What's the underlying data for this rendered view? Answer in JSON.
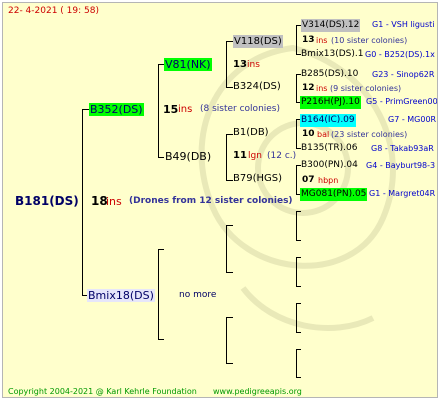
{
  "header": {
    "text": "22-  4-2021  ( 19: 58)"
  },
  "footer": {
    "copyright": "Copyright 2004-2021 @ Karl Kehrle Foundation",
    "website": "www.pedigreeapis.org"
  },
  "root": {
    "id": "B181(DS)",
    "number": "18",
    "ins": "ins",
    "note": "(Drones from 12 sister colonies)"
  },
  "gen1": [
    {
      "id": "B352(DS)",
      "number": "15",
      "ins": "ins",
      "note": "(8 sister colonies)"
    },
    {
      "id": "Bmix18(DS)",
      "note": "no more"
    }
  ],
  "gen2": [
    {
      "id": "V81(NK)",
      "number": "13",
      "ins": "ins"
    },
    {
      "id": "B49(DB)",
      "number": "11",
      "ins": "lgn",
      "note": "(12 c.)"
    }
  ],
  "gen3": [
    {
      "id": "V118(DS)"
    },
    {
      "id": "B324(DS)"
    },
    {
      "id": "B1(DB)"
    },
    {
      "id": "B79(HGS)"
    }
  ],
  "gen4": [
    {
      "id": "V314(DS).12",
      "ref": "G1 - VSH ligusti"
    },
    {
      "number": "13",
      "ins": "ins",
      "note": "(10 sister colonies)"
    },
    {
      "id": "Bmix13(DS).1",
      "ref": "G0 - B252(DS).1x"
    },
    {
      "id": "B285(DS).10",
      "ref": "G23 - Sinop62R"
    },
    {
      "number": "12",
      "ins": "ins",
      "note": "(9 sister colonies)"
    },
    {
      "id": "P216H(PJ).10",
      "ref": "G5 - PrimGreen00"
    },
    {
      "id": "B164(IC).09",
      "ref": "G7 - MG00R"
    },
    {
      "number": "10",
      "ins": "bal",
      "note": "(23 sister colonies)"
    },
    {
      "id": "B135(TR).06",
      "ref": "G8 - Takab93aR"
    },
    {
      "id": "B300(PN).04",
      "ref": "G4 - Bayburt98-3"
    },
    {
      "number": "07",
      "ins": "hbpn"
    },
    {
      "id": "MG081(PN).05",
      "ref": "G1 - Margret04R"
    }
  ],
  "colors": {
    "background": "#ffffcc",
    "green_box": "#00ff00",
    "gray_box": "#c0c0c0",
    "blue_box": "#00ffff",
    "lavender_box": "#e6e6fa",
    "ins_red": "#cc0000",
    "ref_blue": "#0000cc",
    "note_purple": "#333399",
    "footer_green": "#009900"
  }
}
